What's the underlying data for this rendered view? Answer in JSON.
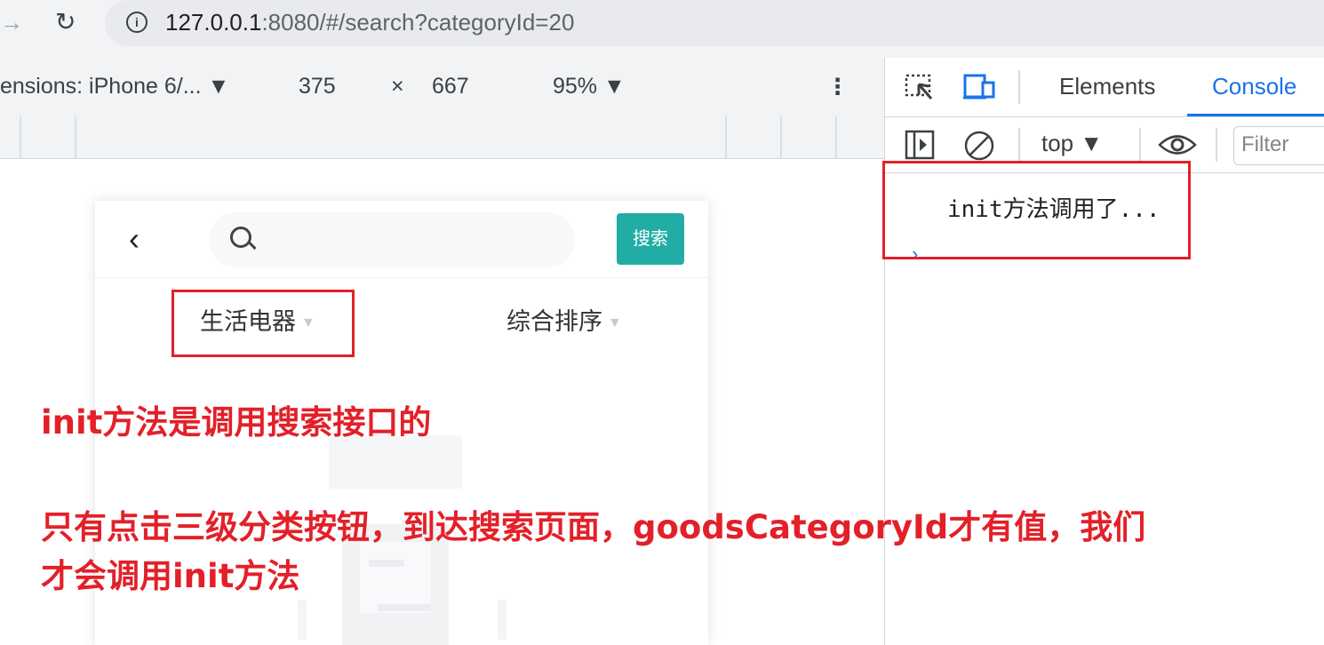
{
  "browser": {
    "url_host": "127.0.0.1",
    "url_rest": ":8080/#/search?categoryId=20"
  },
  "device_toolbar": {
    "dimensions_label": "ensions: iPhone 6/... ▼",
    "width": "375",
    "times": "×",
    "height": "667",
    "zoom": "95% ▼",
    "more": "⋮"
  },
  "devtools": {
    "tabs": [
      "Elements",
      "Console"
    ],
    "active_tab": "Console",
    "context": "top ▼",
    "filter_placeholder": "Filter",
    "console_message": "init方法调用了...",
    "prompt": "›"
  },
  "phone": {
    "back": "‹",
    "search_button": "搜索",
    "filter_category": "生活电器",
    "filter_sort": "综合排序",
    "caret": "▼"
  },
  "annotations": {
    "line1": "init方法是调用搜索接口的",
    "line2": "只有点击三级分类按钮，到达搜索页面，goodsCategoryId才有值，我们",
    "line3": "才会调用init方法"
  },
  "colors": {
    "annotation_red": "#e32029",
    "search_button": "#21ada5",
    "devtools_active": "#1a73e8"
  }
}
